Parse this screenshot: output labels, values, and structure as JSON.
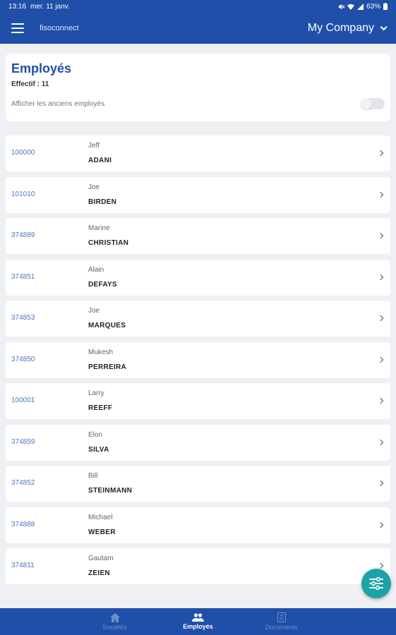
{
  "status_bar": {
    "time": "13:16",
    "date": "mer. 11 janv.",
    "battery": "63%"
  },
  "app_bar": {
    "app_name": "fisoconnect",
    "company": "My Company"
  },
  "header": {
    "title": "Employés",
    "effectif": "Effectif : 11",
    "toggle_label": "Afficher les anciens employés",
    "toggle_on": false
  },
  "employees": [
    {
      "id": "100000",
      "first": "Jeff",
      "last": "ADANI"
    },
    {
      "id": "101010",
      "first": "Joe",
      "last": "BIRDEN"
    },
    {
      "id": "374889",
      "first": "Marine",
      "last": "CHRISTIAN"
    },
    {
      "id": "374851",
      "first": "Alain",
      "last": "DEFAYS"
    },
    {
      "id": "374853",
      "first": "Joe",
      "last": "MARQUES"
    },
    {
      "id": "374850",
      "first": "Mukesh",
      "last": "PERREIRA"
    },
    {
      "id": "100001",
      "first": "Larry",
      "last": "REEFF"
    },
    {
      "id": "374859",
      "first": "Elon",
      "last": "SILVA"
    },
    {
      "id": "374852",
      "first": "Bill",
      "last": "STEINMANN"
    },
    {
      "id": "374888",
      "first": "Michael",
      "last": "WEBER"
    },
    {
      "id": "374811",
      "first": "Gautam",
      "last": "ZEIEN"
    }
  ],
  "bottom_nav": {
    "societes": "Sociétés",
    "employes": "Employés",
    "documents": "Documents"
  },
  "colors": {
    "primary": "#1f4fa8",
    "fab": "#1aa3a8",
    "id_link": "#4a78c2"
  }
}
